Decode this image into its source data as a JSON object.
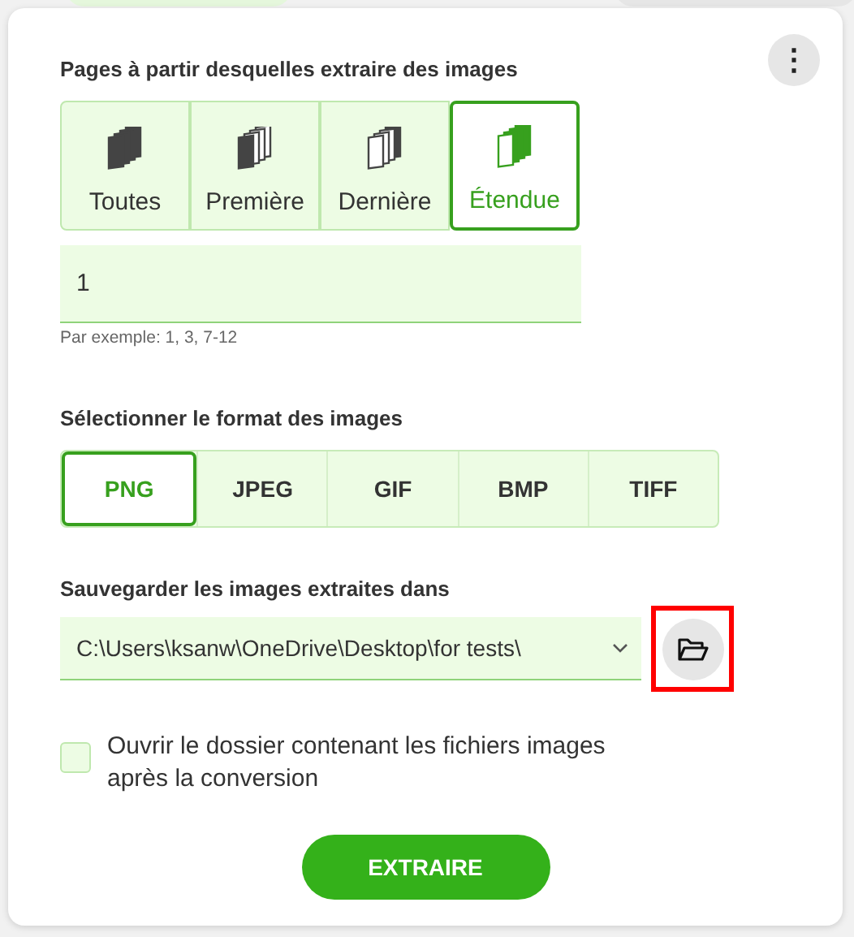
{
  "menu_button": {
    "label": "⋮"
  },
  "pages": {
    "label": "Pages à partir desquelles extraire des images",
    "modes": [
      {
        "label": "Toutes",
        "kind": "all",
        "selected": false
      },
      {
        "label": "Première",
        "kind": "first",
        "selected": false
      },
      {
        "label": "Dernière",
        "kind": "last",
        "selected": false
      },
      {
        "label": "Étendue",
        "kind": "range",
        "selected": true
      }
    ],
    "range_value": "1",
    "hint": "Par exemple: 1, 3, 7-12"
  },
  "format": {
    "label": "Sélectionner le format des images",
    "options": [
      {
        "label": "PNG",
        "selected": true
      },
      {
        "label": "JPEG",
        "selected": false
      },
      {
        "label": "GIF",
        "selected": false
      },
      {
        "label": "BMP",
        "selected": false
      },
      {
        "label": "TIFF",
        "selected": false
      }
    ]
  },
  "output": {
    "label": "Sauvegarder les images extraites dans",
    "path": "C:\\Users\\ksanw\\OneDrive\\Desktop\\for tests\\",
    "browse_highlighted": true
  },
  "open_folder": {
    "label": "Ouvrir le dossier contenant les fichiers images après la conversion",
    "checked": false
  },
  "submit": {
    "label": "EXTRAIRE"
  }
}
